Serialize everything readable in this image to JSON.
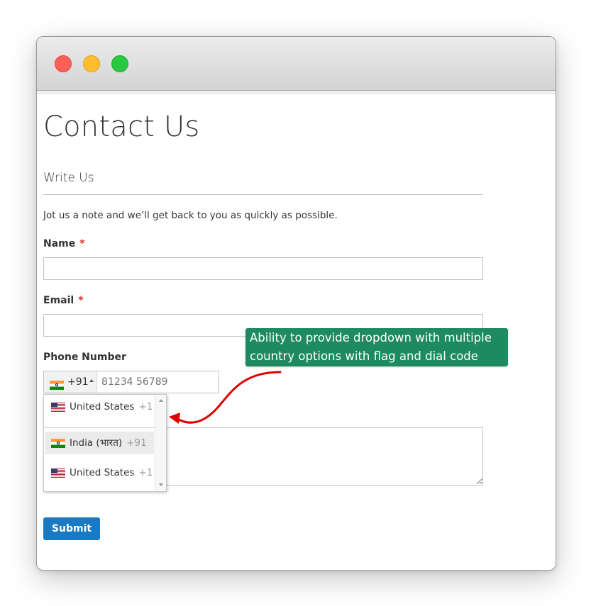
{
  "page": {
    "title": "Contact Us"
  },
  "form": {
    "legend": "Write Us",
    "intro": "Jot us a note and we’ll get back to you as quickly as possible.",
    "name": {
      "label": "Name",
      "required_mark": "*",
      "value": ""
    },
    "email": {
      "label": "Email",
      "required_mark": "*",
      "value": ""
    },
    "phone": {
      "label": "Phone Number",
      "selected_dial_code": "+91",
      "selected_flag": "flag-india-icon",
      "placeholder": "81234 56789",
      "value": ""
    },
    "comment": {
      "value": ""
    },
    "submit_label": "Submit"
  },
  "country_dropdown": {
    "items": [
      {
        "country": "United States",
        "dial": "+1",
        "flag": "flag-us-icon",
        "highlighted": false
      },
      {
        "country": "India (भारत)",
        "dial": "+91",
        "flag": "flag-india-icon",
        "highlighted": true
      },
      {
        "country": "United States",
        "dial": "+1",
        "flag": "flag-us-icon",
        "highlighted": false
      }
    ]
  },
  "annotation": {
    "text": "Ability to provide dropdown with multiple country options with flag and dial code",
    "background": "#1d8a62",
    "arrow_color": "#e00000"
  },
  "colors": {
    "accent": "#1979c3",
    "required": "#e02b27"
  }
}
